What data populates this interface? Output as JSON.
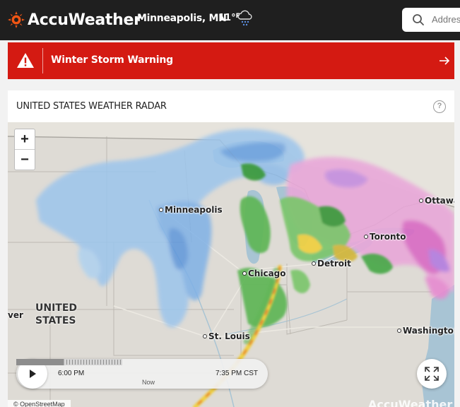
{
  "header": {
    "brand": "AccuWeather",
    "location": "Minneapolis, MN",
    "temperature": "11°",
    "temp_unit": "F",
    "weather_icon": "snow-cloud-icon",
    "search_placeholder": "Address"
  },
  "alert": {
    "label": "Winter Storm Warning",
    "color": "#d41a12"
  },
  "radar": {
    "title": "UNITED STATES WEATHER RADAR",
    "help": "?",
    "cities": {
      "minneapolis": "Minneapolis",
      "chicago": "Chicago",
      "detroit": "Detroit",
      "toronto": "Toronto",
      "ottawa": "Ottawa",
      "st_louis": "St. Louis",
      "washington": "Washington"
    },
    "country_line1": "UNITED",
    "country_line2": "STATES",
    "partial_label": "ver",
    "zoom_in": "+",
    "zoom_out": "−",
    "player": {
      "start_time": "6:00 PM",
      "end_time": "7:35 PM CST",
      "now_label": "Now",
      "progress": 0.45
    },
    "attribution": "© OpenStreetMap",
    "watermark": "AccuWeather"
  },
  "colors": {
    "brand_orange": "#f05514",
    "header_bg": "#1f1f1f",
    "water": "#a8c4d4",
    "land": "#dedbd5"
  }
}
